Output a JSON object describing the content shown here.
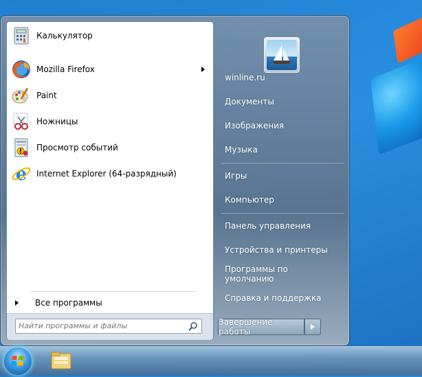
{
  "start_menu": {
    "pinned_programs": [
      {
        "label": "Калькулятор",
        "icon": "calculator-icon",
        "has_submenu": false
      },
      {
        "label": "Mozilla Firefox",
        "icon": "firefox-icon",
        "has_submenu": true
      },
      {
        "label": "Paint",
        "icon": "paint-icon",
        "has_submenu": false
      },
      {
        "label": "Ножницы",
        "icon": "scissors-icon",
        "has_submenu": false
      },
      {
        "label": "Просмотр событий",
        "icon": "event-viewer-icon",
        "has_submenu": false
      },
      {
        "label": "Internet Explorer (64-разрядный)",
        "icon": "internet-explorer-icon",
        "has_submenu": false
      }
    ],
    "all_programs_label": "Все программы",
    "search": {
      "placeholder": "Найти программы и файлы",
      "value": ""
    },
    "right_items": [
      {
        "label": "winline.ru",
        "name": "user-folder"
      },
      {
        "label": "Документы",
        "name": "documents"
      },
      {
        "label": "Изображения",
        "name": "pictures"
      },
      {
        "label": "Музыка",
        "name": "music"
      },
      {
        "label": "Игры",
        "name": "games"
      },
      {
        "label": "Компьютер",
        "name": "computer"
      },
      {
        "label": "Панель управления",
        "name": "control-panel"
      },
      {
        "label": "Устройства и принтеры",
        "name": "devices-printers"
      },
      {
        "label": "Программы по умолчанию",
        "name": "default-programs"
      },
      {
        "label": "Справка и поддержка",
        "name": "help-support"
      }
    ],
    "shutdown_label": "Завершение работы"
  },
  "taskbar": {
    "items": [
      {
        "icon": "windows-start-orb-icon"
      },
      {
        "icon": "windows-explorer-icon"
      }
    ]
  },
  "colors": {
    "desktop": "#1f7fd0",
    "menu_frame": "#5a738c",
    "left_pane": "#ffffff",
    "right_text": "#ffffff"
  }
}
